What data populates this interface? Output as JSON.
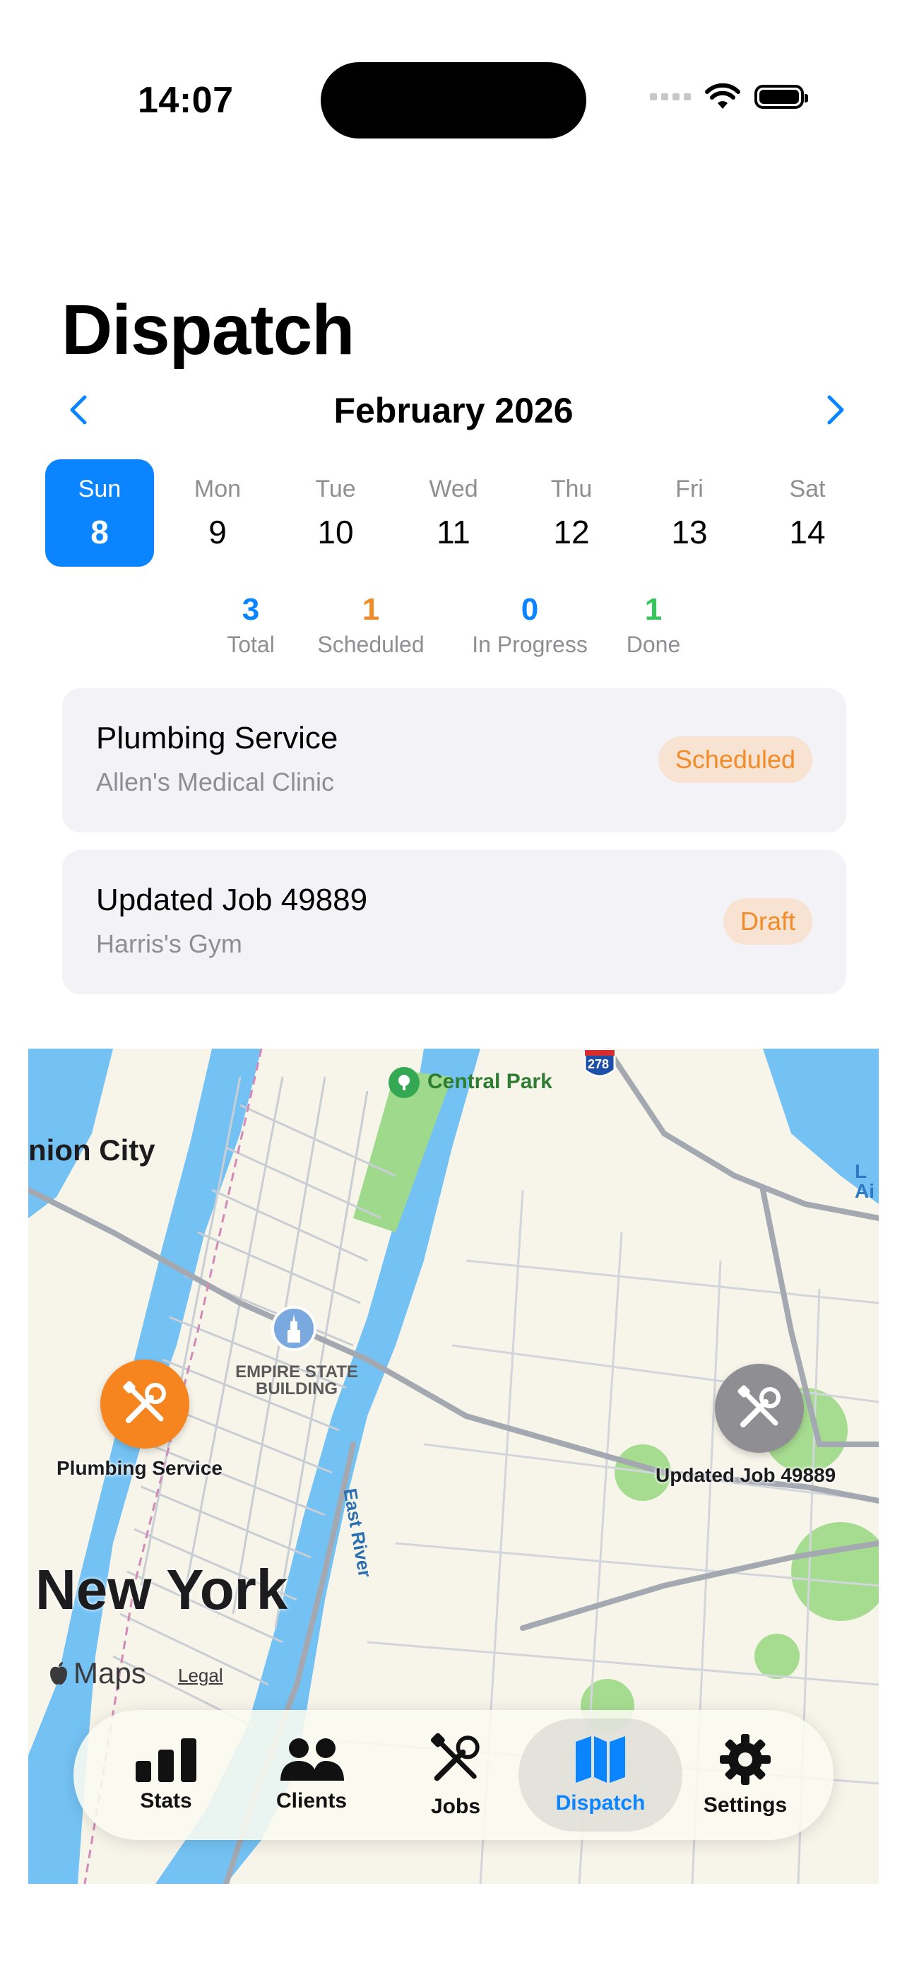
{
  "status_bar": {
    "time": "14:07"
  },
  "page": {
    "title": "Dispatch"
  },
  "calendar": {
    "month_label": "February 2026",
    "days": [
      {
        "name": "Sun",
        "num": "8"
      },
      {
        "name": "Mon",
        "num": "9"
      },
      {
        "name": "Tue",
        "num": "10"
      },
      {
        "name": "Wed",
        "num": "11"
      },
      {
        "name": "Thu",
        "num": "12"
      },
      {
        "name": "Fri",
        "num": "13"
      },
      {
        "name": "Sat",
        "num": "14"
      }
    ],
    "selected_day": "Sun 8"
  },
  "stats": [
    {
      "value": "3",
      "label": "Total",
      "color": "#0a84ff"
    },
    {
      "value": "1",
      "label": "Scheduled",
      "color": "#f28c28"
    },
    {
      "value": "0",
      "label": "In Progress",
      "color": "#0a84ff"
    },
    {
      "value": "1",
      "label": "Done",
      "color": "#34c759"
    }
  ],
  "jobs": [
    {
      "title": "Plumbing Service",
      "client": "Allen's Medical Clinic",
      "status": "Scheduled"
    },
    {
      "title": "Updated Job 49889",
      "client": "Harris's Gym",
      "status": "Draft"
    }
  ],
  "map": {
    "places": {
      "central_park": "Central Park",
      "union_city": "nion City",
      "empire_state": "EMPIRE STATE\nBUILDING",
      "east_river": "East River",
      "new_york": "New York",
      "highway": "278",
      "edge": "L\nAi"
    },
    "attribution": {
      "maps": "Maps",
      "legal": "Legal"
    },
    "pins": [
      {
        "label": "Plumbing Service",
        "color": "#f7851f"
      },
      {
        "label": "Updated Job 49889",
        "color": "#8e8e93"
      }
    ]
  },
  "tabbar": {
    "tabs": [
      {
        "label": "Stats",
        "icon": "bar-chart-icon"
      },
      {
        "label": "Clients",
        "icon": "people-icon"
      },
      {
        "label": "Jobs",
        "icon": "wrench-screwdriver-icon"
      },
      {
        "label": "Dispatch",
        "icon": "map-icon"
      },
      {
        "label": "Settings",
        "icon": "gear-icon"
      }
    ],
    "active": "Dispatch"
  }
}
